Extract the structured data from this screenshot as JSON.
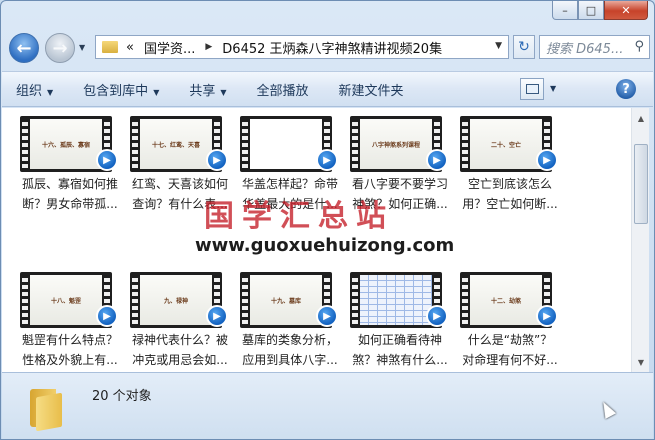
{
  "window": {
    "caption_min": "–",
    "caption_max": "□",
    "caption_close": "✕"
  },
  "address_bar": {
    "overflow": "«",
    "segments": [
      "国学资...",
      "D6452 王炳森八字神煞精讲视频20集"
    ],
    "search_placeholder": "搜索 D645..."
  },
  "toolbar": {
    "items": [
      {
        "label": "组织",
        "dropdown": true
      },
      {
        "label": "包含到库中",
        "dropdown": true
      },
      {
        "label": "共享",
        "dropdown": true
      },
      {
        "label": "全部播放",
        "dropdown": false
      },
      {
        "label": "新建文件夹",
        "dropdown": false
      }
    ],
    "help": "?"
  },
  "files": [
    {
      "thumb_text": "十六、孤辰、寡宿",
      "style": "light",
      "line1": "孤辰、寡宿如何推",
      "line2": "断？男女命带孤..."
    },
    {
      "thumb_text": "十七、红鸾、天喜",
      "style": "light",
      "line1": "红鸾、天喜该如何",
      "line2": "查询？有什么表..."
    },
    {
      "thumb_text": "",
      "style": "doc",
      "line1": "华盖怎样起？命带",
      "line2": "华盖最大的是什..."
    },
    {
      "thumb_text": "八字神煞系列课程",
      "style": "light",
      "line1": "看八字要不要学习",
      "line2": "神煞？如何正确..."
    },
    {
      "thumb_text": "二十、空亡",
      "style": "light",
      "line1": "空亡到底该怎么",
      "line2": "用？空亡如何断..."
    },
    {
      "thumb_text": "十八、魁罡",
      "style": "light",
      "line1": "魁罡有什么特点？",
      "line2": "性格及外貌上有..."
    },
    {
      "thumb_text": "九、禄神",
      "style": "light",
      "line1": "禄神代表什么？被",
      "line2": "冲克或用忌会如..."
    },
    {
      "thumb_text": "十九、墓库",
      "style": "light",
      "line1": "墓库的类象分析，",
      "line2": "应用到具体八字..."
    },
    {
      "thumb_text": "",
      "style": "grid",
      "line1": "如何正确看待神",
      "line2": "煞？神煞有什么..."
    },
    {
      "thumb_text": "十二、劫煞",
      "style": "light",
      "line1": "什么是“劫煞”？",
      "line2": "对命理有何不好..."
    }
  ],
  "watermark": {
    "cn": "国学汇总站",
    "url": "www.guoxuehuizong.com"
  },
  "status": {
    "count_text": "20 个对象"
  }
}
